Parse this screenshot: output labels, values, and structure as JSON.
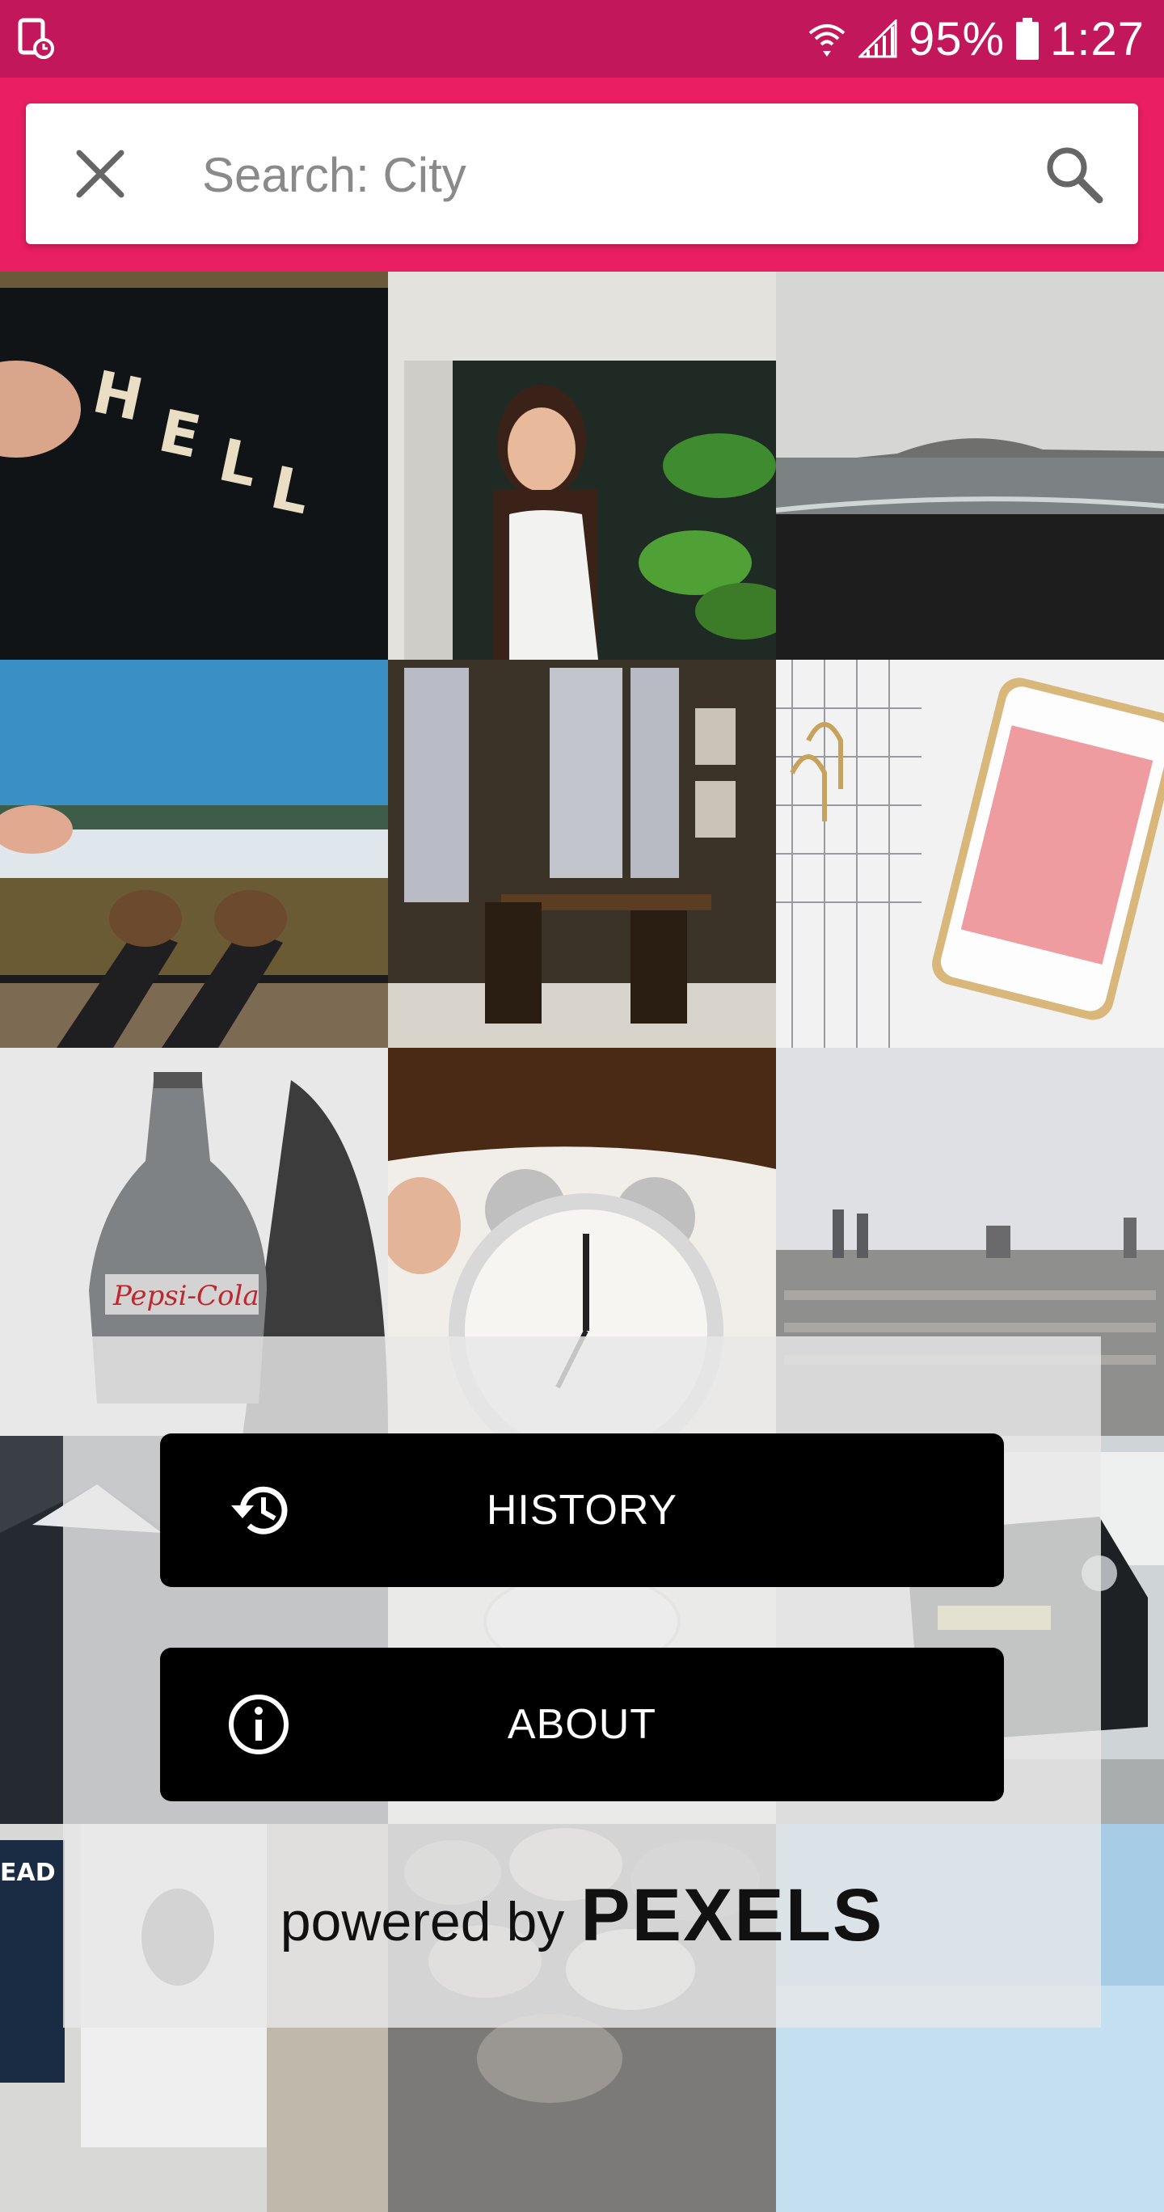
{
  "status_bar": {
    "battery": "95%",
    "time": "1:27",
    "icons": [
      "screenshot-icon",
      "wifi-icon",
      "signal-icon",
      "battery-icon"
    ]
  },
  "search": {
    "placeholder": "Search: City",
    "value": "",
    "close_icon": "close-icon",
    "search_icon": "search-icon"
  },
  "photos": [
    {
      "subject": "hello-letter-board"
    },
    {
      "subject": "woman-in-doorway"
    },
    {
      "subject": "sea-shore"
    },
    {
      "subject": "feet-over-landscape"
    },
    {
      "subject": "cafe-interior"
    },
    {
      "subject": "phone-on-desk"
    },
    {
      "subject": "soda-bottle"
    },
    {
      "subject": "alarm-clock"
    },
    {
      "subject": "city-skyline"
    },
    {
      "subject": "mountains"
    },
    {
      "subject": "coffee-cup"
    },
    {
      "subject": "classic-car"
    },
    {
      "subject": "street-poster"
    },
    {
      "subject": "pebbles"
    },
    {
      "subject": "sky"
    }
  ],
  "menu": {
    "history_label": "HISTORY",
    "about_label": "ABOUT",
    "history_icon": "history-icon",
    "about_icon": "info-icon"
  },
  "footer": {
    "powered_by": "powered by",
    "brand": "PEXELS"
  },
  "colors": {
    "status_bar": "#c2185b",
    "app_bar": "#e91e63",
    "button": "#000000"
  }
}
